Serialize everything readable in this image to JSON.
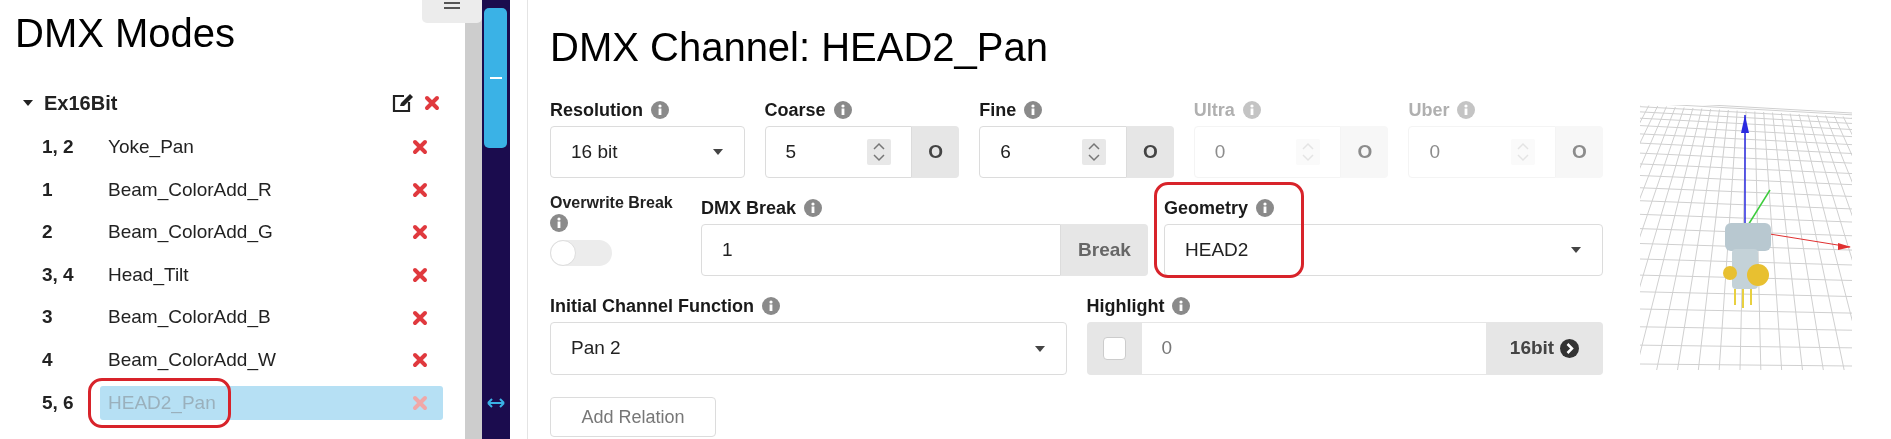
{
  "sidebar": {
    "title": "DMX Modes",
    "mode": {
      "name": "Ex16Bit",
      "expanded": true
    },
    "channels": [
      {
        "number": "1, 2",
        "name": "Yoke_Pan",
        "selected": false,
        "circled": false
      },
      {
        "number": "1",
        "name": "Beam_ColorAdd_R",
        "selected": false,
        "circled": false
      },
      {
        "number": "2",
        "name": "Beam_ColorAdd_G",
        "selected": false,
        "circled": false
      },
      {
        "number": "3, 4",
        "name": "Head_Tilt",
        "selected": false,
        "circled": false
      },
      {
        "number": "3",
        "name": "Beam_ColorAdd_B",
        "selected": false,
        "circled": false
      },
      {
        "number": "4",
        "name": "Beam_ColorAdd_W",
        "selected": false,
        "circled": false
      },
      {
        "number": "5, 6",
        "name": "HEAD2_Pan",
        "selected": true,
        "circled": true
      }
    ]
  },
  "main": {
    "title": "DMX Channel: HEAD2_Pan",
    "resolution": {
      "label": "Resolution",
      "value": "16 bit"
    },
    "offsets": [
      {
        "label": "Coarse",
        "value": "5",
        "addon": "O",
        "disabled": false
      },
      {
        "label": "Fine",
        "value": "6",
        "addon": "O",
        "disabled": false
      },
      {
        "label": "Ultra",
        "value": "0",
        "addon": "O",
        "disabled": true
      },
      {
        "label": "Uber",
        "value": "0",
        "addon": "O",
        "disabled": true
      }
    ],
    "overwrite_break": {
      "label": "Overwrite Break",
      "on": false
    },
    "dmx_break": {
      "label": "DMX Break",
      "value": "1",
      "addon": "Break"
    },
    "geometry": {
      "label": "Geometry",
      "value": "HEAD2",
      "circled": true
    },
    "initial_function": {
      "label": "Initial Channel Function",
      "value": "Pan 2"
    },
    "highlight": {
      "label": "Highlight",
      "checked": false,
      "value": "0",
      "addon": "16bit"
    },
    "add_relation": "Add Relation"
  }
}
